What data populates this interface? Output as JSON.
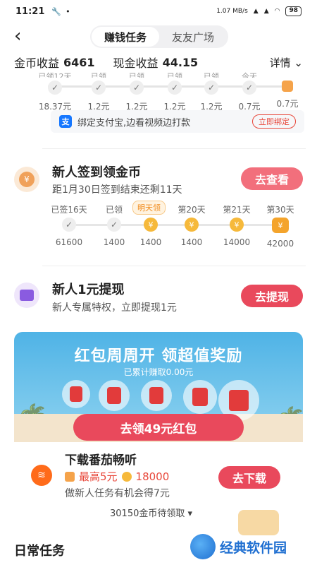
{
  "status_bar": {
    "time": "11:21",
    "speed": "1.07 MB/s",
    "battery": "98"
  },
  "nav": {
    "tabs": [
      {
        "label": "赚钱任务",
        "active": true
      },
      {
        "label": "友友广场",
        "active": false
      }
    ]
  },
  "earnings": {
    "coin_label": "金币收益",
    "coin_value": "6461",
    "cash_label": "现金收益",
    "cash_value": "44.15",
    "detail_label": "详情"
  },
  "top_steps": [
    {
      "top": "已领12天",
      "value": "18.37元"
    },
    {
      "top": "已领",
      "value": "1.2元"
    },
    {
      "top": "已领",
      "value": "1.2元"
    },
    {
      "top": "已领",
      "value": "1.2元"
    },
    {
      "top": "已领",
      "value": "1.2元"
    },
    {
      "top": "今天",
      "value": "0.7元"
    },
    {
      "top": "",
      "value": "0.7元"
    }
  ],
  "alipay": {
    "text": "绑定支付宝,边看视频边打款",
    "button": "立即绑定"
  },
  "signin": {
    "title": "新人签到领金币",
    "subtitle": "距1月30日签到结束还剩11天",
    "button": "去查看",
    "tomorrow_label": "明天领",
    "steps": [
      {
        "top": "已签16天",
        "value": "61600"
      },
      {
        "top": "已领",
        "value": "1400"
      },
      {
        "top": "",
        "value": "1400"
      },
      {
        "top": "第20天",
        "value": "1400"
      },
      {
        "top": "第21天",
        "value": "14000"
      },
      {
        "top": "第30天",
        "value": "42000"
      }
    ]
  },
  "withdraw": {
    "title": "新人1元提现",
    "subtitle": "新人专属特权，立即提现1元",
    "button": "去提现"
  },
  "banner": {
    "title": "红包周周开 领超值奖励",
    "subtitle": "已累计赚取0.00元",
    "button": "去领49元红包"
  },
  "download": {
    "title": "下载番茄畅听",
    "max_reward": "最高5元",
    "coins": "18000",
    "desc": "做新人任务有机会得7元",
    "button": "去下载",
    "pending": "30150金币待领取"
  },
  "daily": {
    "title": "日常任务"
  },
  "watermark": {
    "text": "经典软件园"
  }
}
